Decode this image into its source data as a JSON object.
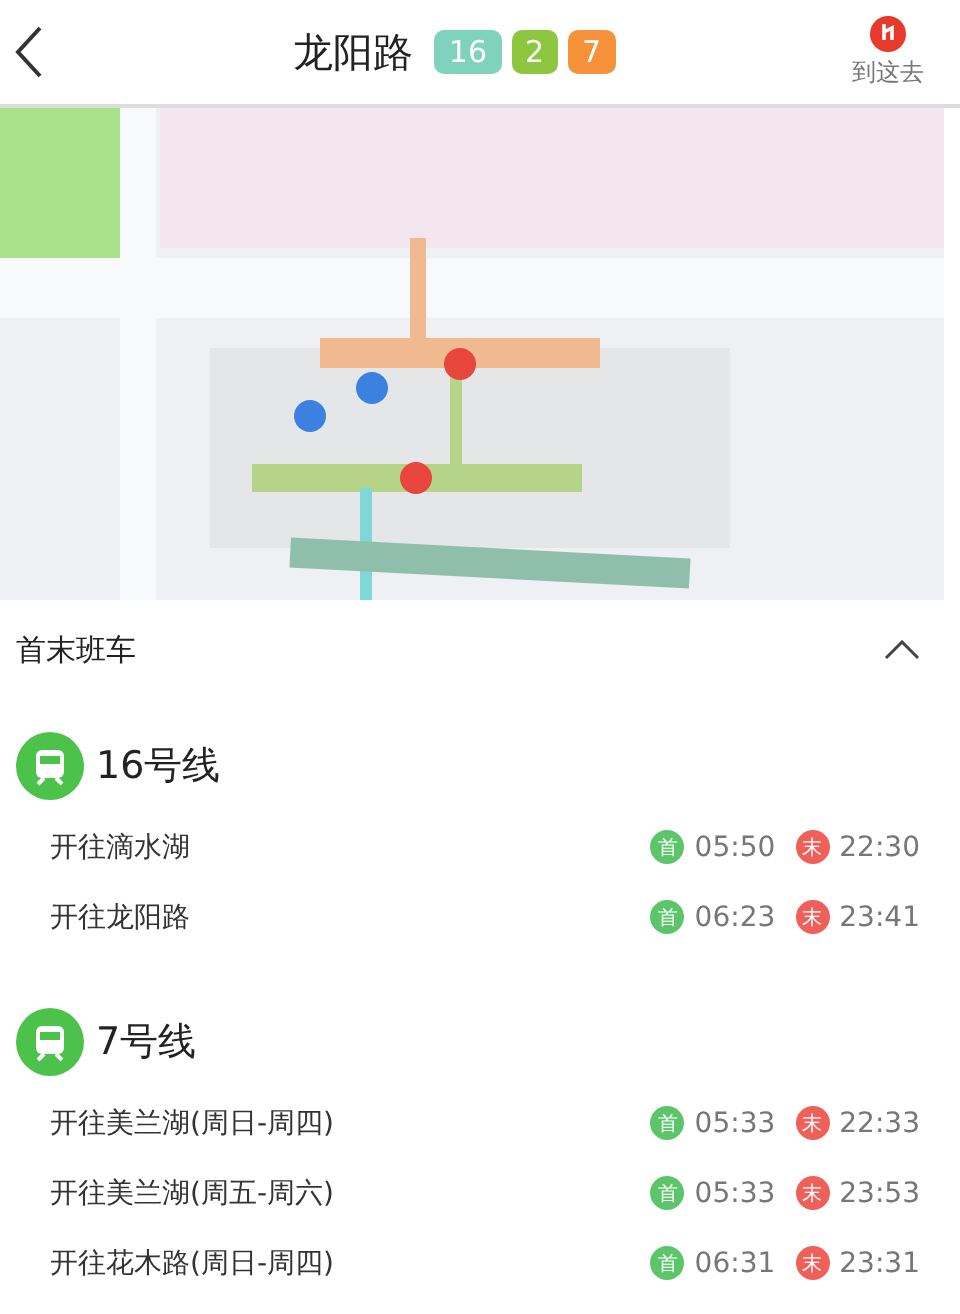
{
  "header": {
    "title": "龙阳路",
    "lines": [
      {
        "label": "16",
        "color": "#7fd3bd"
      },
      {
        "label": "2",
        "color": "#8dc63f"
      },
      {
        "label": "7",
        "color": "#f5923a"
      }
    ],
    "go_label": "到这去"
  },
  "section": {
    "title": "首末班车",
    "expanded": true
  },
  "groups": [
    {
      "name": "16号线",
      "rows": [
        {
          "direction": "开往滴水湖",
          "first_tag": "首",
          "first": "05:50",
          "last_tag": "末",
          "last": "22:30"
        },
        {
          "direction": "开往龙阳路",
          "first_tag": "首",
          "first": "06:23",
          "last_tag": "末",
          "last": "23:41"
        }
      ]
    },
    {
      "name": "7号线",
      "rows": [
        {
          "direction": "开往美兰湖(周日-周四)",
          "first_tag": "首",
          "first": "05:33",
          "last_tag": "末",
          "last": "22:33"
        },
        {
          "direction": "开往美兰湖(周五-周六)",
          "first_tag": "首",
          "first": "05:33",
          "last_tag": "末",
          "last": "23:53"
        },
        {
          "direction": "开往花木路(周日-周四)",
          "first_tag": "首",
          "first": "06:31",
          "last_tag": "末",
          "last": "23:31"
        }
      ]
    }
  ]
}
